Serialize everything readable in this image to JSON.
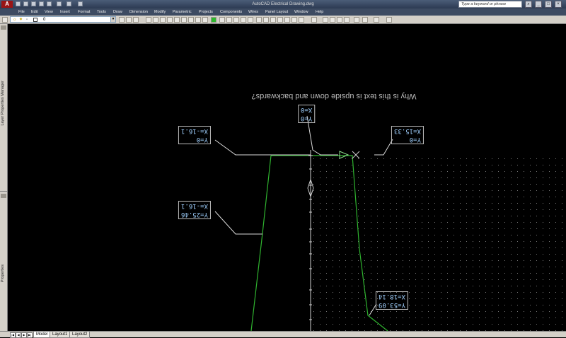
{
  "app": {
    "title": "AutoCAD Electrical    Drawing.dwg",
    "logo_letter": "A"
  },
  "search": {
    "placeholder": "Type a keyword or phrase"
  },
  "window_controls": [
    "_",
    "□",
    "×"
  ],
  "menu": [
    "File",
    "Edit",
    "View",
    "Insert",
    "Format",
    "Tools",
    "Draw",
    "Dimension",
    "Modify",
    "Parametric",
    "Projects",
    "Components",
    "Wires",
    "Panel Layout",
    "Window",
    "Help"
  ],
  "layer": {
    "current": "0"
  },
  "palettes": {
    "layer_manager": "Layer Properties Manager",
    "properties": "Properties"
  },
  "drawing": {
    "annotation": "Why is this text is upside down and backwards?",
    "coords": [
      {
        "name": "coord-box-top",
        "x": "X=0",
        "y": "Y=0"
      },
      {
        "name": "coord-box-left-top",
        "x": "X=-16.1",
        "y": "Y=0"
      },
      {
        "name": "coord-box-right-top",
        "x": "X=15.33",
        "y": "Y=0"
      },
      {
        "name": "coord-box-left-bottom",
        "x": "X=-16.1",
        "y": "Y=25.46"
      },
      {
        "name": "coord-box-right-bottom",
        "x": "X=18.14",
        "y": "Y=53.09"
      }
    ]
  },
  "tabs": {
    "model": "Model",
    "layout1": "Layout1",
    "layout2": "Layout2"
  },
  "colors": {
    "profile_line": "#2fb32f",
    "leader": "#d8d8d8",
    "coord_text": "#9fd0ff"
  }
}
